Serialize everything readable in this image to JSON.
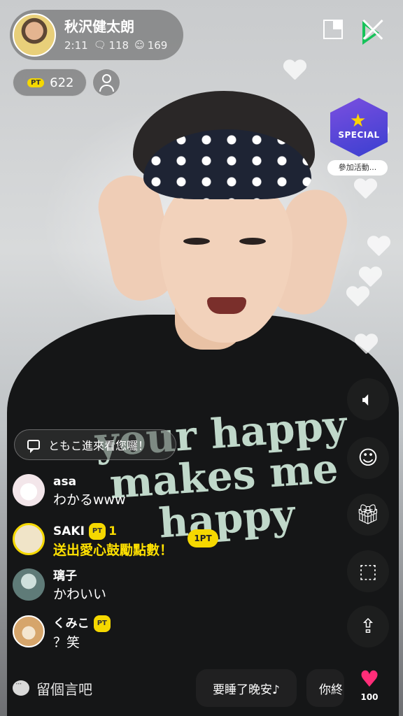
{
  "streamer": {
    "name": "秋沢健太朗",
    "duration": "2:11",
    "comments": "118",
    "viewers": "169"
  },
  "points": {
    "badge": "PT",
    "value": "622"
  },
  "event": {
    "badge_text": "SPECIAL",
    "join_label": "參加活動..."
  },
  "shirt_text": [
    "your happy",
    "makes me",
    "happy"
  ],
  "notice": "ともこ進來看您囉！",
  "chat": [
    {
      "name": "asa",
      "message": "わかるwww",
      "avatar_color": "#f3e6ea"
    },
    {
      "name": "SAKI",
      "badge": "PT",
      "badge_value": "1",
      "message": "送出愛心鼓勵點數！",
      "avatar_color": "#f0e4c8",
      "gift_label": "1PT"
    },
    {
      "name": "璃子",
      "message": "かわいい",
      "avatar_color": "#9fb6b0"
    },
    {
      "name": "くみこ",
      "badge": "PT",
      "message": "？笑",
      "avatar_color": "#d6a56b"
    }
  ],
  "bottom": {
    "comment_placeholder": "留個言吧",
    "quick_replies": [
      "要睡了晚安♪",
      "你終"
    ],
    "likes": "100"
  },
  "rail_icons": [
    "speaker-icon",
    "users-icon",
    "gift-icon",
    "camera-scan-icon",
    "share-icon"
  ],
  "colors": {
    "accent_yellow": "#f5d800",
    "heart_pink": "#ff2d78",
    "line_green": "#16c35a"
  }
}
